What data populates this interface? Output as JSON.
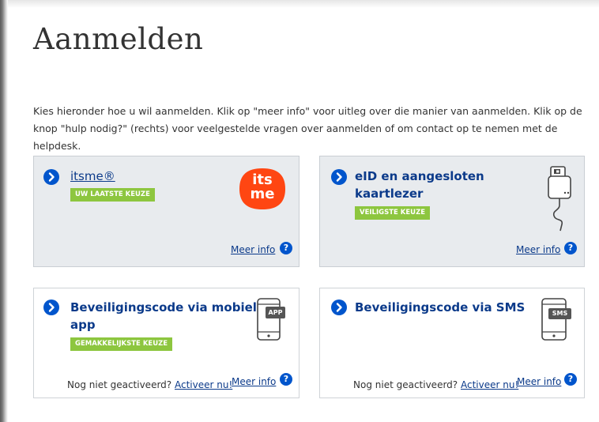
{
  "page": {
    "title": "Aanmelden",
    "intro": "Kies hieronder hoe u wil aanmelden. Klik op \"meer info\" voor uitleg over die manier van aanmelden. Klik op de knop \"hulp nodig?\" (rechts) voor veelgestelde vragen over aanmelden of om contact op te nemen met de helpdesk."
  },
  "options": [
    {
      "title": "itsme®",
      "badge": "UW LAATSTE KEUZE",
      "meer_info": "Meer info",
      "help_glyph": "?",
      "icon": "itsme-logo-icon",
      "logo_text_1": "its",
      "logo_text_2": "me"
    },
    {
      "title_line1": "eID en aangesloten",
      "title_line2": "kaartlezer",
      "badge": "VEILIGSTE KEUZE",
      "meer_info": "Meer info",
      "help_glyph": "?",
      "icon": "card-reader-icon"
    },
    {
      "title_line1": "Beveiligingscode via mobiele",
      "title_line2": "app",
      "badge": "GEMAKKELIJKSTE KEUZE",
      "meer_info": "Meer info",
      "help_glyph": "?",
      "not_activated": "Nog niet geactiveerd?",
      "activate": "Activeer nu!",
      "icon": "phone-app-icon",
      "icon_label": "APP"
    },
    {
      "title": "Beveiligingscode via SMS",
      "meer_info": "Meer info",
      "help_glyph": "?",
      "not_activated": "Nog niet geactiveerd?",
      "activate": "Activeer nu!",
      "icon": "phone-sms-icon",
      "icon_label": "SMS"
    }
  ],
  "colors": {
    "link_blue": "#0b3a8a",
    "chevron_blue": "#0055cc",
    "badge_green": "#8dc63f",
    "card_grey": "#e8ebee",
    "itsme_red": "#ff4612"
  }
}
